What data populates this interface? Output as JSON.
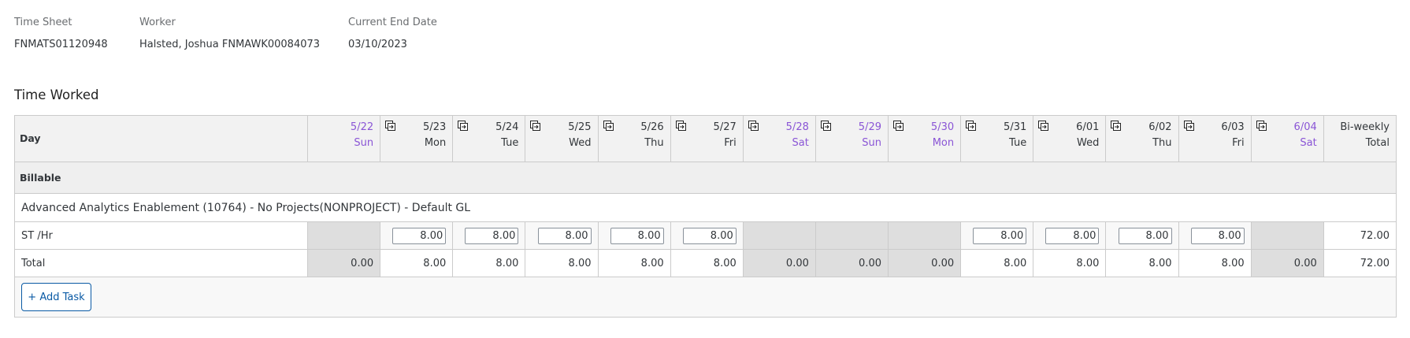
{
  "header": {
    "time_sheet": {
      "label": "Time Sheet",
      "value": "FNMATS01120948"
    },
    "worker": {
      "label": "Worker",
      "value": "Halsted, Joshua FNMAWK00084073"
    },
    "end_date": {
      "label": "Current End Date",
      "value": "03/10/2023"
    }
  },
  "section_title": "Time Worked",
  "table": {
    "day_label": "Day",
    "total_label_1": "Bi-weekly",
    "total_label_2": "Total",
    "days": [
      {
        "date": "5/22",
        "dow": "Sun",
        "weekend": true,
        "copy": false,
        "entry": "",
        "total": "0.00"
      },
      {
        "date": "5/23",
        "dow": "Mon",
        "weekend": false,
        "copy": true,
        "entry": "8.00",
        "total": "8.00"
      },
      {
        "date": "5/24",
        "dow": "Tue",
        "weekend": false,
        "copy": true,
        "entry": "8.00",
        "total": "8.00"
      },
      {
        "date": "5/25",
        "dow": "Wed",
        "weekend": false,
        "copy": true,
        "entry": "8.00",
        "total": "8.00"
      },
      {
        "date": "5/26",
        "dow": "Thu",
        "weekend": false,
        "copy": true,
        "entry": "8.00",
        "total": "8.00"
      },
      {
        "date": "5/27",
        "dow": "Fri",
        "weekend": false,
        "copy": true,
        "entry": "8.00",
        "total": "8.00"
      },
      {
        "date": "5/28",
        "dow": "Sat",
        "weekend": true,
        "copy": true,
        "entry": "",
        "total": "0.00"
      },
      {
        "date": "5/29",
        "dow": "Sun",
        "weekend": true,
        "copy": true,
        "entry": "",
        "total": "0.00"
      },
      {
        "date": "5/30",
        "dow": "Mon",
        "weekend": true,
        "copy": true,
        "entry": "",
        "total": "0.00"
      },
      {
        "date": "5/31",
        "dow": "Tue",
        "weekend": false,
        "copy": true,
        "entry": "8.00",
        "total": "8.00"
      },
      {
        "date": "6/01",
        "dow": "Wed",
        "weekend": false,
        "copy": true,
        "entry": "8.00",
        "total": "8.00"
      },
      {
        "date": "6/02",
        "dow": "Thu",
        "weekend": false,
        "copy": true,
        "entry": "8.00",
        "total": "8.00"
      },
      {
        "date": "6/03",
        "dow": "Fri",
        "weekend": false,
        "copy": true,
        "entry": "8.00",
        "total": "8.00"
      },
      {
        "date": "6/04",
        "dow": "Sat",
        "weekend": true,
        "copy": true,
        "entry": "",
        "total": "0.00"
      }
    ],
    "billable_label": "Billable",
    "project": "Advanced Analytics Enablement (10764) - No Projects(NONPROJECT) - Default GL",
    "st_label": "ST /Hr",
    "st_total": "72.00",
    "total_label": "Total",
    "grand_total": "72.00",
    "add_task_label": "+ Add Task"
  },
  "colors": {
    "weekend": "#8a55d6",
    "button": "#0a5aa5"
  }
}
